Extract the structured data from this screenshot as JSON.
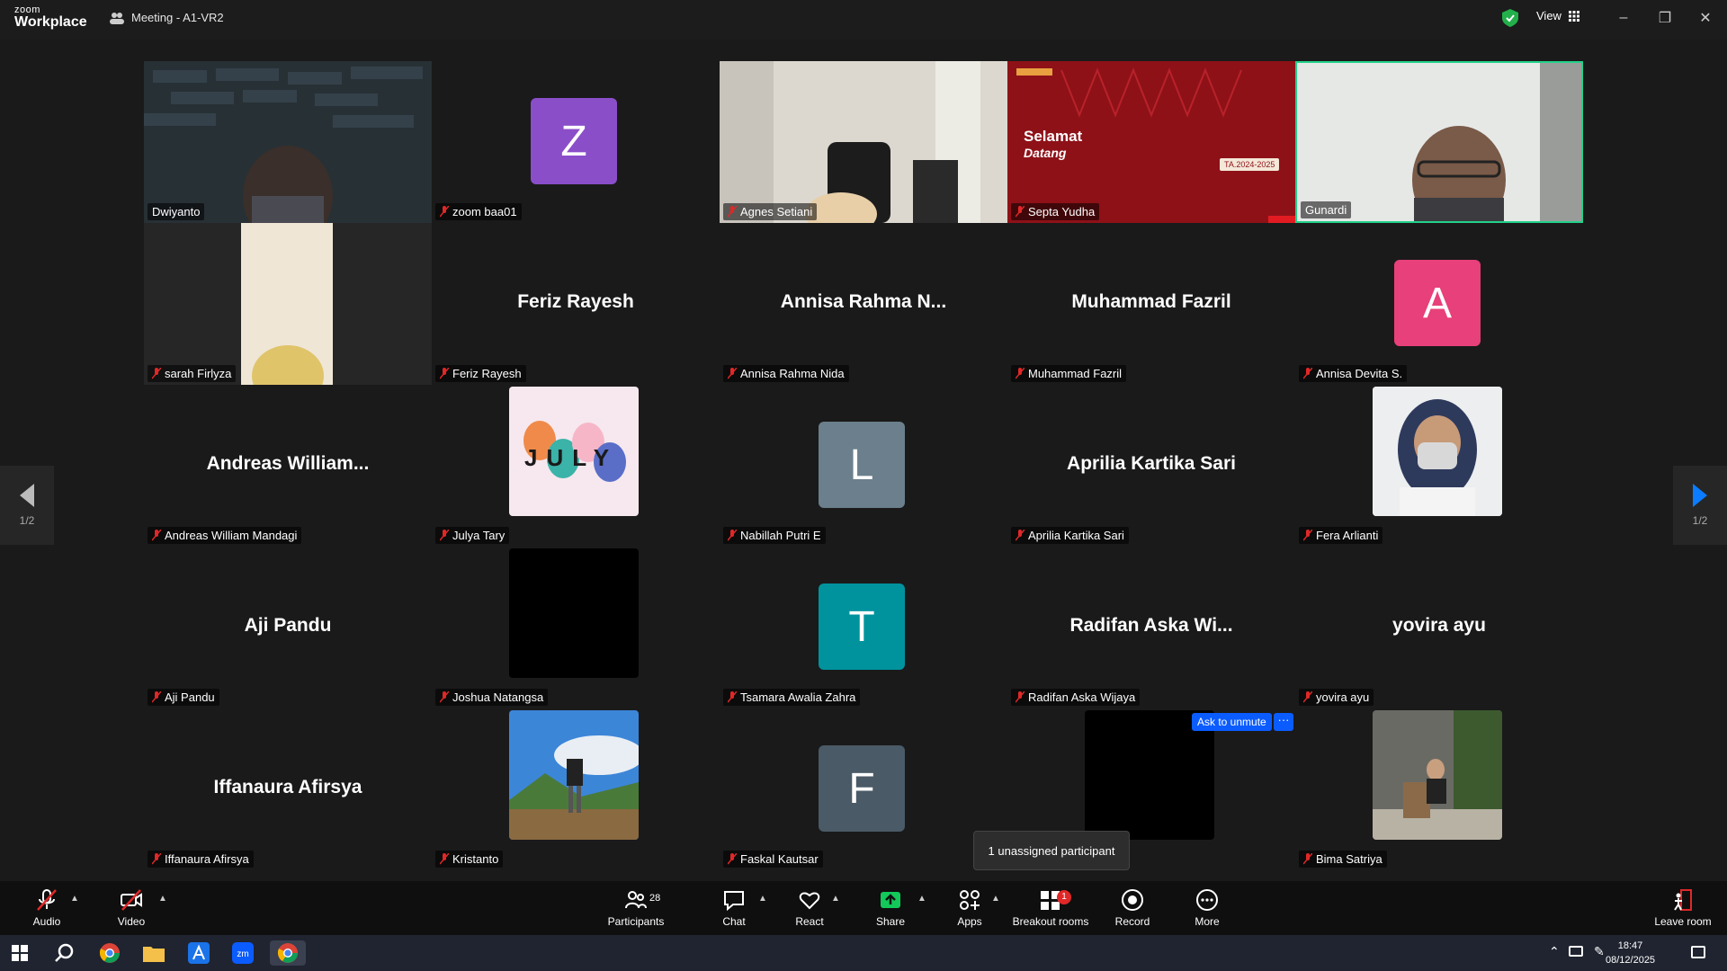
{
  "app": {
    "logo_top": "zoom",
    "logo_bottom": "Workplace",
    "meeting_title": "Meeting - A1-VR2",
    "view_label": "View"
  },
  "nav": {
    "page_left": "1/2",
    "page_right": "1/2"
  },
  "tiles": [
    {
      "name": "Dwiyanto"
    },
    {
      "name": "zoom baa01",
      "initial": "Z",
      "color": "#8b4ec9"
    },
    {
      "name": "Agnes Setiani"
    },
    {
      "name": "Septa Yudha",
      "slide_title": "Selamat",
      "slide_sub": "Datang",
      "slide_badge": "TA.2024-2025"
    },
    {
      "name": "Gunardi"
    },
    {
      "name": "sarah Firlyza"
    },
    {
      "name": "Feriz Rayesh",
      "display": "Feriz Rayesh"
    },
    {
      "name": "Annisa Rahma Nida",
      "display": "Annisa Rahma N..."
    },
    {
      "name": "Muhammad Fazril",
      "display": "Muhammad Fazril"
    },
    {
      "name": "Annisa Devita S.",
      "initial": "A",
      "color": "#e8407a"
    },
    {
      "name": "Andreas William Mandagi",
      "display": "Andreas William..."
    },
    {
      "name": "Julya Tary",
      "photo_text": "JULY"
    },
    {
      "name": "Nabillah Putri E",
      "initial": "L",
      "color": "#6b7f8c"
    },
    {
      "name": "Aprilia Kartika Sari",
      "display": "Aprilia Kartika Sari"
    },
    {
      "name": "Fera Arlianti"
    },
    {
      "name": "Aji Pandu",
      "display": "Aji Pandu"
    },
    {
      "name": "Joshua Natangsa"
    },
    {
      "name": "Tsamara Awalia Zahra",
      "initial": "T",
      "color": "#00939e"
    },
    {
      "name": "Radifan Aska Wijaya",
      "display": "Radifan Aska Wi..."
    },
    {
      "name": "yovira ayu",
      "display": "yovira ayu"
    },
    {
      "name": "Iffanaura Afirsya",
      "display": "Iffanaura Afirsya"
    },
    {
      "name": "Kristanto"
    },
    {
      "name": "Faskal Kautsar",
      "initial": "F",
      "color": "#4a5a66"
    },
    {
      "name": ""
    },
    {
      "name": "Bima Satriya"
    }
  ],
  "overlay": {
    "ask_unmute": "Ask to unmute",
    "more": "···",
    "tooltip": "1 unassigned participant"
  },
  "toolbar": {
    "audio": "Audio",
    "video": "Video",
    "participants": "Participants",
    "participants_count": "28",
    "chat": "Chat",
    "react": "React",
    "share": "Share",
    "apps": "Apps",
    "breakout": "Breakout rooms",
    "breakout_badge": "1",
    "record": "Record",
    "more": "More",
    "leave": "Leave room"
  },
  "taskbar": {
    "time": "18:47",
    "date": "08/12/2025"
  },
  "colors": {
    "active_speaker": "#23d18b",
    "accent": "#0b5cff",
    "share": "#12c95a"
  }
}
